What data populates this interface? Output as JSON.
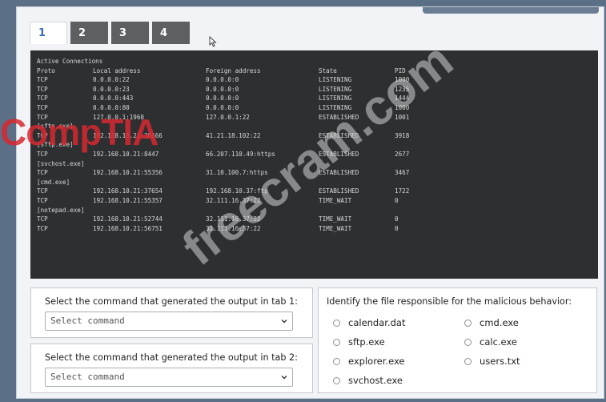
{
  "tabs": [
    {
      "label": "1",
      "active": true
    },
    {
      "label": "2",
      "active": false
    },
    {
      "label": "3",
      "active": false
    },
    {
      "label": "4",
      "active": false
    }
  ],
  "terminal": {
    "title": "Active Connections",
    "headers": [
      "Proto",
      "Local address",
      "Foreign address",
      "State",
      "PID"
    ],
    "lines": [
      {
        "type": "row",
        "cols": [
          "TCP",
          "0.0.0.0:22",
          "0.0.0.0:0",
          "LISTENING",
          "1000"
        ]
      },
      {
        "type": "row",
        "cols": [
          "TCP",
          "0.0.0.0:23",
          "0.0.0.0:0",
          "LISTENING",
          "1235"
        ]
      },
      {
        "type": "row",
        "cols": [
          "TCP",
          "0.0.0.0:443",
          "0.0.0.0:0",
          "LISTENING",
          "1444"
        ]
      },
      {
        "type": "row",
        "cols": [
          "TCP",
          "0.0.0.0:80",
          "0.0.0.0:0",
          "LISTENING",
          "1000"
        ]
      },
      {
        "type": "row",
        "cols": [
          "TCP",
          "127.0.0.1:1960",
          "127.0.0.1:22",
          "ESTABLISHED",
          "1001"
        ]
      },
      {
        "type": "proc",
        "text": "[sftp.exe]"
      },
      {
        "type": "row",
        "cols": [
          "TCP",
          "192.168.10.21:38666",
          "41.21.18.102:22",
          "ESTABLISHED",
          "3918"
        ]
      },
      {
        "type": "proc",
        "text": "[sftp.exe]"
      },
      {
        "type": "row",
        "cols": [
          "TCP",
          "192.168.10.21:8447",
          "66.207.110.49:https",
          "ESTABLISHED",
          "2677"
        ]
      },
      {
        "type": "proc",
        "text": "[svchost.exe]"
      },
      {
        "type": "row",
        "cols": [
          "TCP",
          "192.168.10.21:55356",
          "31.10.100.7:https",
          "ESTABLISHED",
          "3467"
        ]
      },
      {
        "type": "proc",
        "text": "[cmd.exe]"
      },
      {
        "type": "row",
        "cols": [
          "TCP",
          "192.168.10.21:37654",
          "192.168.10.37:ftp",
          "ESTABLISHED",
          "1722"
        ]
      },
      {
        "type": "row",
        "cols": [
          "TCP",
          "192.168.10.21:55357",
          "32.111.16.37:22",
          "TIME_WAIT",
          "0"
        ]
      },
      {
        "type": "proc",
        "text": "[notepad.exe]"
      },
      {
        "type": "row",
        "cols": [
          "TCP",
          "192.168.10.21:52744",
          "32.111.16.37:22",
          "TIME_WAIT",
          "0"
        ]
      },
      {
        "type": "row",
        "cols": [
          "TCP",
          "192.168.10.21:56751",
          "32.111.16.37:22",
          "TIME_WAIT",
          "0"
        ]
      }
    ]
  },
  "question1": {
    "label": "Select the command that generated the output in tab 1:",
    "placeholder": "Select command"
  },
  "question2": {
    "label": "Select the command that generated the output in tab 2:",
    "placeholder": "Select command"
  },
  "question3": {
    "label": "Identify the file responsible for the malicious behavior:",
    "options": [
      "calendar.dat",
      "cmd.exe",
      "sftp.exe",
      "calc.exe",
      "explorer.exe",
      "users.txt",
      "svchost.exe"
    ]
  },
  "watermarks": {
    "brand": "CompTIA",
    "site": "freecram.com"
  },
  "colors": {
    "background": "#5b6f86",
    "terminal_bg": "#2d2f31",
    "tab_inactive": "#5d5f63",
    "tab_active_text": "#3b6db0",
    "brand_red": "#d62830"
  }
}
